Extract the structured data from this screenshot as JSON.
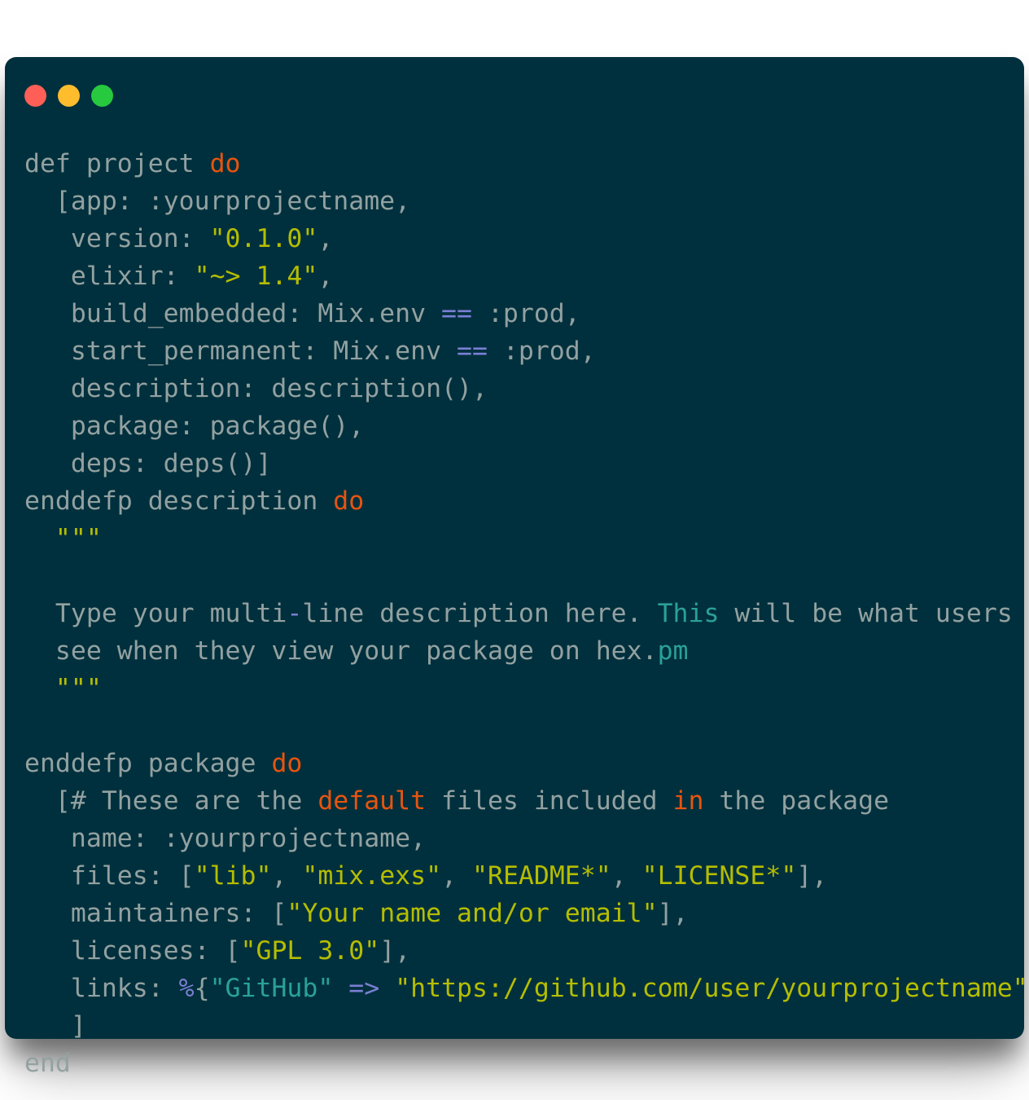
{
  "window": {
    "title": "",
    "background_color": "#00303d",
    "traffic_lights": [
      {
        "name": "close",
        "color": "#ff5f56",
        "label": ""
      },
      {
        "name": "minimize",
        "color": "#ffbd2e",
        "label": ""
      },
      {
        "name": "maximize",
        "color": "#27c93f",
        "label": ""
      }
    ]
  },
  "theme": {
    "background": "#00303d",
    "foreground": "#93a1a1",
    "keyword": "#e8540f",
    "string": "#b5bd00",
    "operator": "#7b7fd4",
    "cyan": "#2aa198",
    "page_background": "#ffffff"
  },
  "code": {
    "language": "elixir",
    "filename": "mix.exs",
    "lines": [
      {
        "id": "l1",
        "tokens": [
          {
            "t": "def project ",
            "c": "default"
          },
          {
            "t": "do",
            "c": "keyword"
          }
        ]
      },
      {
        "id": "l2",
        "tokens": [
          {
            "t": "  [app: :yourprojectname,",
            "c": "default"
          }
        ]
      },
      {
        "id": "l3",
        "tokens": [
          {
            "t": "   version: ",
            "c": "default"
          },
          {
            "t": "\"0.1.0\"",
            "c": "string"
          },
          {
            "t": ",",
            "c": "default"
          }
        ]
      },
      {
        "id": "l4",
        "tokens": [
          {
            "t": "   elixir: ",
            "c": "default"
          },
          {
            "t": "\"~> 1.4\"",
            "c": "string"
          },
          {
            "t": ",",
            "c": "default"
          }
        ]
      },
      {
        "id": "l5",
        "tokens": [
          {
            "t": "   build_embedded: Mix.env ",
            "c": "default"
          },
          {
            "t": "==",
            "c": "operator"
          },
          {
            "t": " :prod,",
            "c": "default"
          }
        ]
      },
      {
        "id": "l6",
        "tokens": [
          {
            "t": "   start_permanent: Mix.env ",
            "c": "default"
          },
          {
            "t": "==",
            "c": "operator"
          },
          {
            "t": " :prod,",
            "c": "default"
          }
        ]
      },
      {
        "id": "l7",
        "tokens": [
          {
            "t": "   description: description(),",
            "c": "default"
          }
        ]
      },
      {
        "id": "l8",
        "tokens": [
          {
            "t": "   package: package(),",
            "c": "default"
          }
        ]
      },
      {
        "id": "l9",
        "tokens": [
          {
            "t": "   deps: deps()]",
            "c": "default"
          }
        ]
      },
      {
        "id": "l10",
        "tokens": [
          {
            "t": "enddefp description ",
            "c": "default"
          },
          {
            "t": "do",
            "c": "keyword"
          }
        ]
      },
      {
        "id": "l11",
        "tokens": [
          {
            "t": "  \"\"\"",
            "c": "string"
          }
        ]
      },
      {
        "id": "l12",
        "tokens": [
          {
            "t": "",
            "c": "default"
          }
        ]
      },
      {
        "id": "l13",
        "tokens": [
          {
            "t": "  Type your multi",
            "c": "default"
          },
          {
            "t": "-",
            "c": "operator"
          },
          {
            "t": "line description here. ",
            "c": "default"
          },
          {
            "t": "This",
            "c": "cyan"
          },
          {
            "t": " will be what users",
            "c": "default"
          }
        ]
      },
      {
        "id": "l14",
        "tokens": [
          {
            "t": "  see when they view your package on hex.",
            "c": "default"
          },
          {
            "t": "pm",
            "c": "cyan"
          }
        ]
      },
      {
        "id": "l15",
        "tokens": [
          {
            "t": "  \"\"\"",
            "c": "string"
          }
        ]
      },
      {
        "id": "l16",
        "tokens": [
          {
            "t": "",
            "c": "default"
          }
        ]
      },
      {
        "id": "l17",
        "tokens": [
          {
            "t": "enddefp package ",
            "c": "default"
          },
          {
            "t": "do",
            "c": "keyword"
          }
        ]
      },
      {
        "id": "l18",
        "tokens": [
          {
            "t": "  [# These are the ",
            "c": "default"
          },
          {
            "t": "default",
            "c": "keyword"
          },
          {
            "t": " files included ",
            "c": "default"
          },
          {
            "t": "in",
            "c": "keyword"
          },
          {
            "t": " the package",
            "c": "default"
          }
        ]
      },
      {
        "id": "l19",
        "tokens": [
          {
            "t": "   name: :yourprojectname,",
            "c": "default"
          }
        ]
      },
      {
        "id": "l20",
        "tokens": [
          {
            "t": "   files: [",
            "c": "default"
          },
          {
            "t": "\"lib\"",
            "c": "string"
          },
          {
            "t": ", ",
            "c": "default"
          },
          {
            "t": "\"mix.exs\"",
            "c": "string"
          },
          {
            "t": ", ",
            "c": "default"
          },
          {
            "t": "\"README*\"",
            "c": "string"
          },
          {
            "t": ", ",
            "c": "default"
          },
          {
            "t": "\"LICENSE*\"",
            "c": "string"
          },
          {
            "t": "],",
            "c": "default"
          }
        ]
      },
      {
        "id": "l21",
        "tokens": [
          {
            "t": "   maintainers: [",
            "c": "default"
          },
          {
            "t": "\"Your name and/or email\"",
            "c": "string"
          },
          {
            "t": "],",
            "c": "default"
          }
        ]
      },
      {
        "id": "l22",
        "tokens": [
          {
            "t": "   licenses: [",
            "c": "default"
          },
          {
            "t": "\"GPL 3.0\"",
            "c": "string"
          },
          {
            "t": "],",
            "c": "default"
          }
        ]
      },
      {
        "id": "l23",
        "tokens": [
          {
            "t": "   links: ",
            "c": "default"
          },
          {
            "t": "%",
            "c": "operator"
          },
          {
            "t": "{",
            "c": "default"
          },
          {
            "t": "\"GitHub\"",
            "c": "cyan"
          },
          {
            "t": " ",
            "c": "default"
          },
          {
            "t": "=>",
            "c": "operator"
          },
          {
            "t": " ",
            "c": "default"
          },
          {
            "t": "\"https://github.com/user/yourprojectname\"",
            "c": "string"
          },
          {
            "t": "}",
            "c": "default"
          }
        ]
      },
      {
        "id": "l24",
        "tokens": [
          {
            "t": "   ]",
            "c": "default"
          }
        ]
      },
      {
        "id": "l25",
        "tokens": [
          {
            "t": "end",
            "c": "default"
          }
        ]
      }
    ]
  }
}
